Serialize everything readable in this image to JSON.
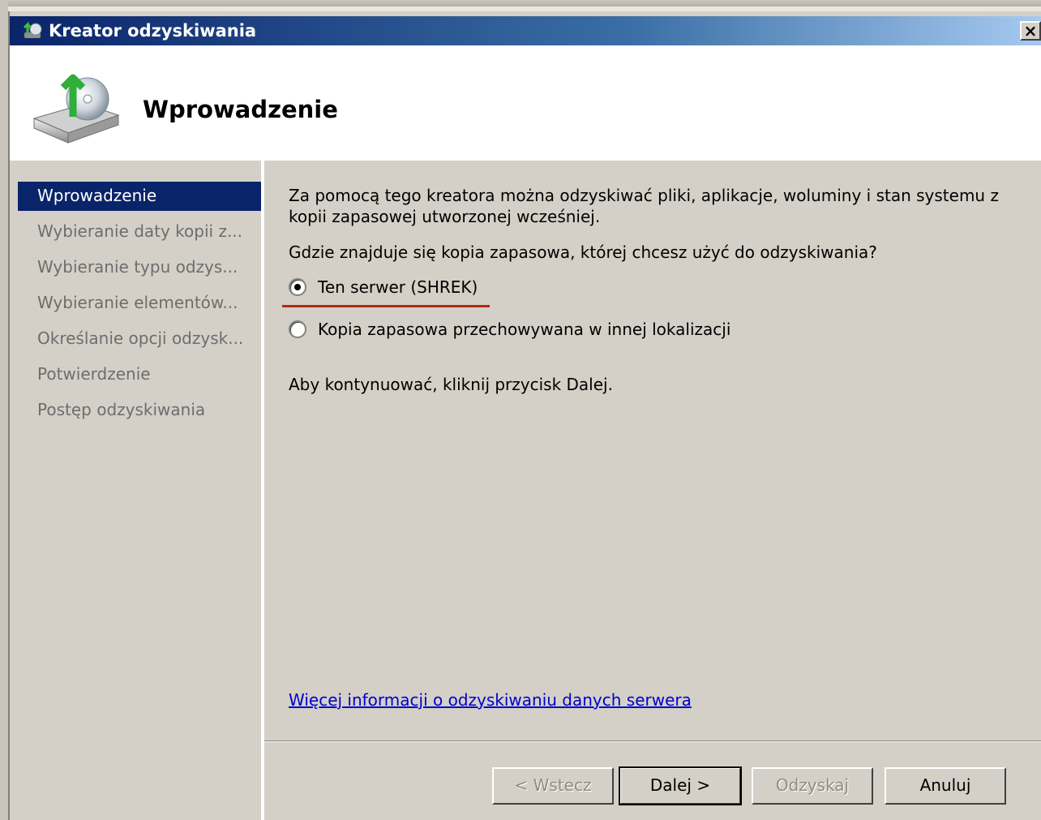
{
  "window": {
    "title": "Kreator odzyskiwania",
    "close_label": "×"
  },
  "header": {
    "title": "Wprowadzenie",
    "icon": "backup-restore-disk-icon"
  },
  "sidebar": {
    "items": [
      {
        "label": "Wprowadzenie",
        "active": true
      },
      {
        "label": "Wybieranie daty kopii z...",
        "active": false
      },
      {
        "label": "Wybieranie typu odzys...",
        "active": false
      },
      {
        "label": "Wybieranie elementów...",
        "active": false
      },
      {
        "label": "Określanie opcji odzysk...",
        "active": false
      },
      {
        "label": "Potwierdzenie",
        "active": false
      },
      {
        "label": "Postęp odzyskiwania",
        "active": false
      }
    ]
  },
  "main": {
    "intro": "Za pomocą tego kreatora można odzyskiwać pliki, aplikacje, woluminy i stan systemu z kopii zapasowej utworzonej wcześniej.",
    "question": "Gdzie znajduje się kopia zapasowa, której chcesz użyć do odzyskiwania?",
    "options": [
      {
        "label": "Ten serwer (SHREK)",
        "selected": true
      },
      {
        "label": "Kopia zapasowa przechowywana w innej lokalizacji",
        "selected": false
      }
    ],
    "continue_text": "Aby kontynuować, kliknij przycisk Dalej.",
    "link_text": "Więcej informacji o odzyskiwaniu danych serwera"
  },
  "buttons": {
    "back": "< Wstecz",
    "next": "Dalej >",
    "recover": "Odzyskaj",
    "cancel": "Anuluj"
  },
  "colors": {
    "titlebar": "#0a246a",
    "selected_item": "#0a246a",
    "dialog_bg": "#d4d0c8",
    "link": "#0000cc",
    "annotation_underline": "#b02a15"
  }
}
